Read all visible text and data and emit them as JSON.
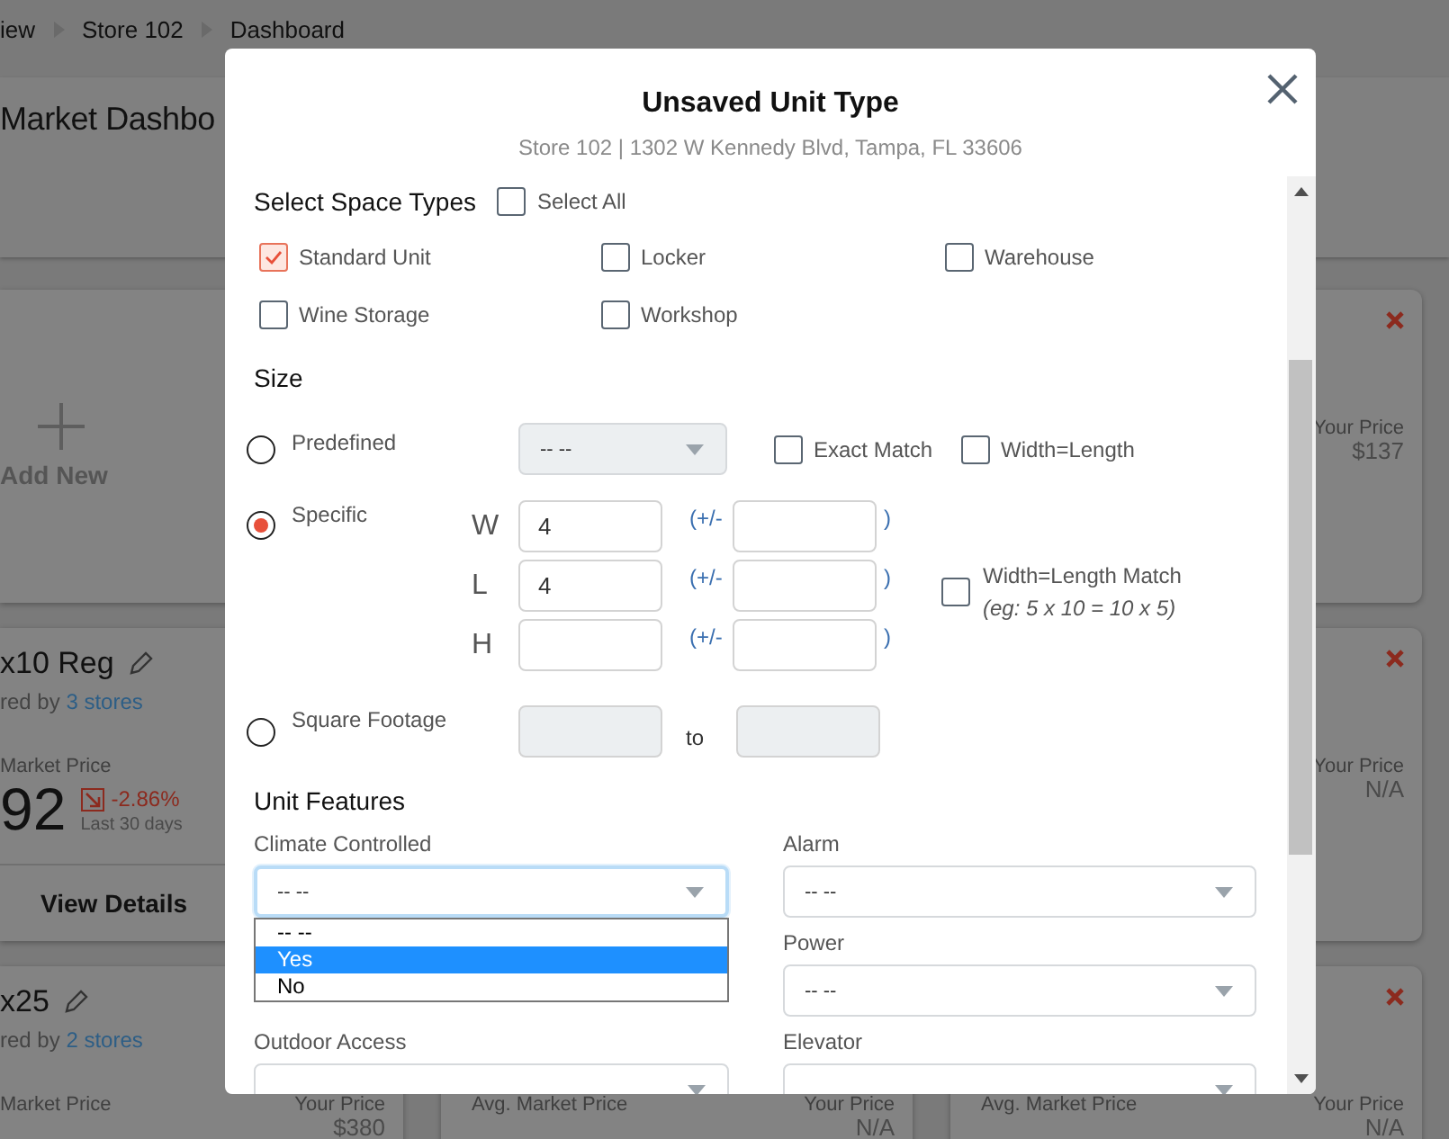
{
  "breadcrumb": [
    {
      "label": "iew"
    },
    {
      "label": "Store 102"
    },
    {
      "label": "Dashboard"
    }
  ],
  "page_title": "Market Dashbo",
  "card_columns": [
    [
      {
        "kind": "add",
        "label": "Add New"
      },
      {
        "kind": "unit",
        "title": "x10 Reg",
        "shared_text": "red by",
        "stores": "3 stores",
        "market_label": "Market Price",
        "market_price": "92",
        "change": "-2.86%",
        "falling": true,
        "period": "Last 30 days",
        "action": "View Details"
      },
      {
        "kind": "unit",
        "title": "x25",
        "shared_text": "red by",
        "stores": "2 stores",
        "market_label": "Market Price",
        "your_label": "Your Price",
        "your_price": "$380"
      }
    ],
    [
      {
        "kind": "price",
        "market_label": "Avg. Market Price",
        "your_label": "Your Price",
        "your_price": "N/A"
      }
    ],
    [
      {
        "kind": "price",
        "removable": true,
        "your_label": "Your Price",
        "your_price": "$137"
      },
      {
        "kind": "price",
        "removable": true,
        "your_label": "Your Price",
        "your_price": "N/A"
      },
      {
        "kind": "price",
        "removable": true,
        "market_label": "Avg. Market Price",
        "your_label": "Your Price",
        "your_price": "N/A"
      }
    ]
  ],
  "modal": {
    "title": "Unsaved Unit Type",
    "subtitle": "Store 102 | 1302 W Kennedy Blvd, Tampa, FL 33606",
    "space_types": {
      "heading": "Select Space Types",
      "select_all": {
        "label": "Select All",
        "checked": false
      },
      "items": [
        {
          "label": "Standard Unit",
          "checked": true
        },
        {
          "label": "Locker",
          "checked": false
        },
        {
          "label": "Warehouse",
          "checked": false
        },
        {
          "label": "Wine Storage",
          "checked": false
        },
        {
          "label": "Workshop",
          "checked": false
        }
      ]
    },
    "size": {
      "heading": "Size",
      "options": [
        {
          "kind": "predefined",
          "label": "Predefined",
          "selected": false,
          "select": {
            "value": "-- --",
            "disabled": true
          },
          "checks": [
            {
              "label": "Exact Match",
              "checked": false
            },
            {
              "label": "Width=Length",
              "checked": false
            }
          ]
        },
        {
          "kind": "specific",
          "label": "Specific",
          "selected": true,
          "dims": [
            {
              "axis": "W",
              "value": "4",
              "open": "(+/-",
              "close": ")"
            },
            {
              "axis": "L",
              "value": "4",
              "open": "(+/-",
              "close": ")"
            },
            {
              "axis": "H",
              "open": "(+/-",
              "close": ")"
            }
          ],
          "match": {
            "label": "Width=Length Match",
            "hint": "(eg: 5 x 10 = 10 x 5)",
            "checked": false
          }
        },
        {
          "kind": "range",
          "label": "Square Footage",
          "selected": false,
          "separator": "to",
          "disabled": true
        }
      ]
    },
    "features": {
      "heading": "Unit Features",
      "columns": [
        [
          {
            "label": "Climate Controlled",
            "value": "-- --",
            "expanded": true,
            "options": [
              {
                "label": "-- --",
                "highlighted": false
              },
              {
                "label": "Yes",
                "highlighted": true
              },
              {
                "label": "No",
                "highlighted": false
              }
            ]
          },
          {
            "label": "Outdoor Access",
            "expanded": false
          }
        ],
        [
          {
            "label": "Alarm",
            "value": "-- --",
            "expanded": false
          },
          {
            "label": "Power",
            "value": "-- --",
            "expanded": false
          },
          {
            "label": "Elevator",
            "expanded": false
          }
        ]
      ]
    }
  }
}
